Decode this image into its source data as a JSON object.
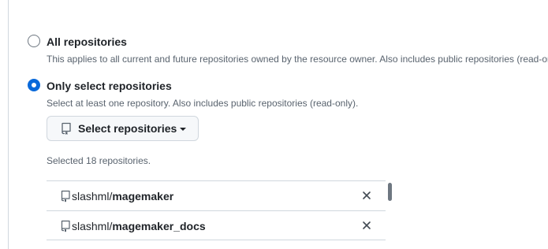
{
  "options": {
    "all": {
      "title": "All repositories",
      "description": "This applies to all current and future repositories owned by the resource owner. Also includes public repositories (read-only).",
      "checked": false
    },
    "select": {
      "title": "Only select repositories",
      "description": "Select at least one repository. Also includes public repositories (read-only).",
      "checked": true
    }
  },
  "select_button": {
    "label": "Select repositories",
    "icon": "repo-icon"
  },
  "selected_count": "Selected 18 repositories.",
  "repositories": [
    {
      "owner": "slashml/",
      "name": "magemaker"
    },
    {
      "owner": "slashml/",
      "name": "magemaker_docs"
    }
  ],
  "colors": {
    "accent": "#0969da",
    "border": "#d0d7de",
    "muted_text": "#59636e"
  }
}
